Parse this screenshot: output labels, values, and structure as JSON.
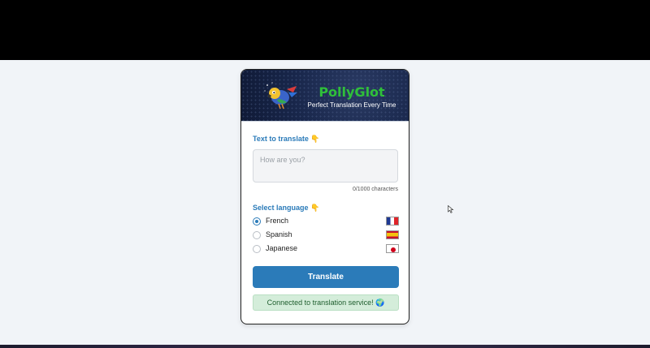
{
  "app": {
    "title": "PollyGlot",
    "subtitle": "Perfect Translation Every Time"
  },
  "input": {
    "label": "Text to translate",
    "label_emoji": "👇",
    "value": "",
    "placeholder": "How are you?",
    "char_count": "0/1000 characters"
  },
  "languages": {
    "label": "Select language",
    "label_emoji": "👇",
    "options": [
      {
        "name": "French",
        "flag": "france-flag",
        "selected": true
      },
      {
        "name": "Spanish",
        "flag": "spain-flag",
        "selected": false
      },
      {
        "name": "Japanese",
        "flag": "japan-flag",
        "selected": false
      }
    ]
  },
  "actions": {
    "translate_label": "Translate"
  },
  "status": {
    "text": "Connected to translation service! 🌍"
  },
  "colors": {
    "accent": "#2b7bb9",
    "brand_green": "#2fbf3a",
    "header_bg": "#18264a",
    "status_bg": "#d4edda"
  }
}
